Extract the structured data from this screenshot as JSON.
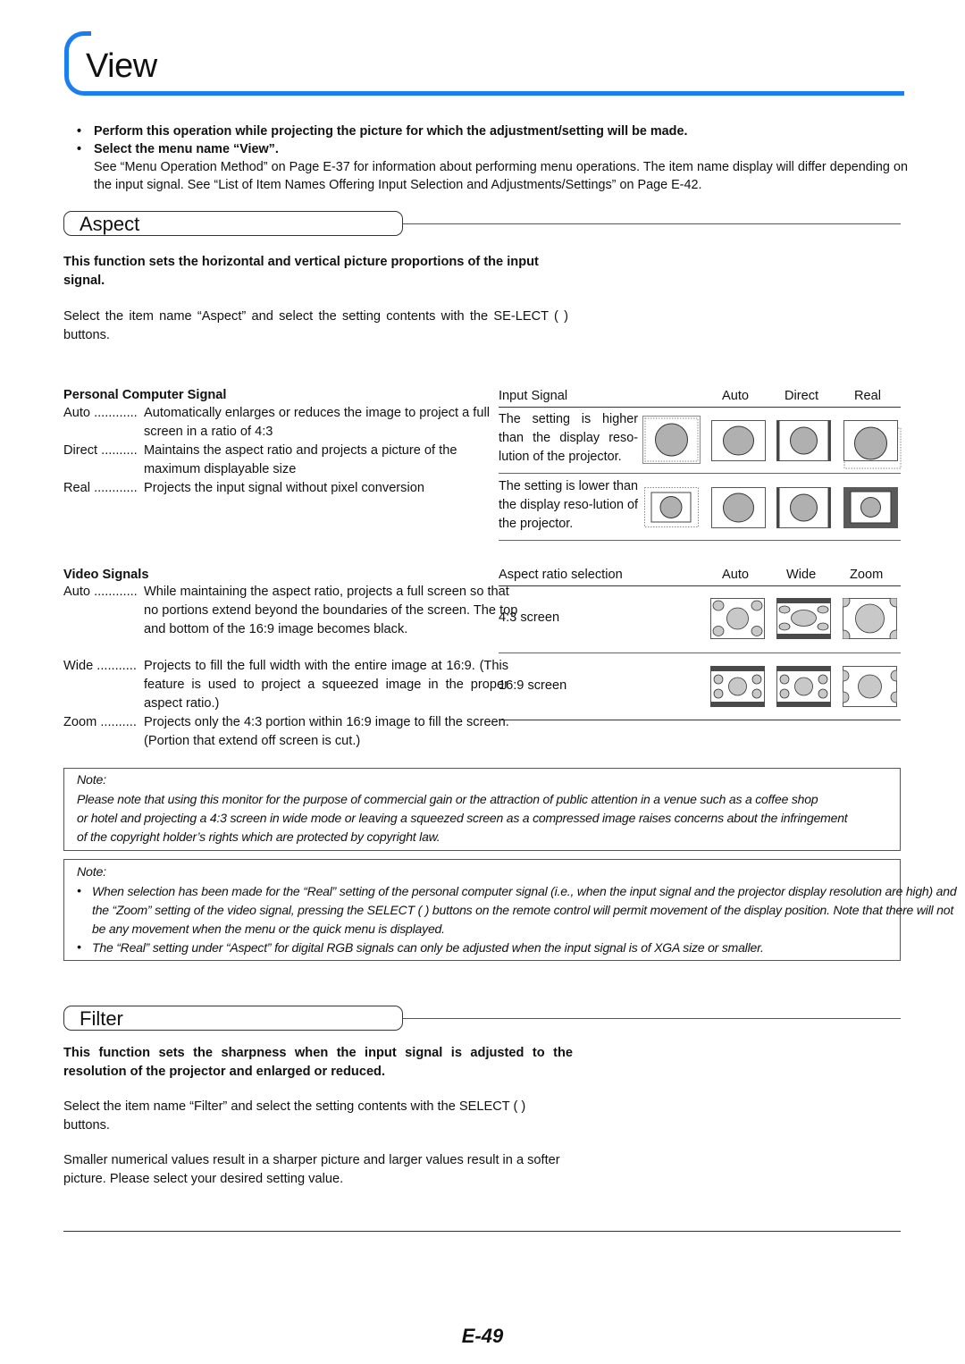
{
  "page": {
    "title": "View",
    "page_number": "E-49",
    "accent_color": "#1a7ef0"
  },
  "intro": {
    "bullet_1": "Perform this operation while projecting the picture for which the adjustment/setting will be made.",
    "bullet_2": "Select the menu name “View”.",
    "paragraph": "See “Menu Operation Method” on Page E-37 for information about performing menu operations. The item name display will differ depending on the input signal. See “List of Item Names Offering Input Selection and Adjustments/Settings” on Page E-42."
  },
  "aspect": {
    "heading": "Aspect",
    "summary": "This function sets the horizontal and vertical picture proportions of the input signal.",
    "instruction": "Select the item name “Aspect” and select the setting contents with the SE-LECT (      ) buttons.",
    "pc_signal": {
      "heading": "Personal Computer Signal",
      "items": [
        {
          "term": "Auto ............",
          "desc": "Automatically enlarges or reduces the image to project a full screen in a ratio of 4:3"
        },
        {
          "term": "Direct ..........",
          "desc": "Maintains the aspect ratio and projects a picture of the maximum displayable size"
        },
        {
          "term": "Real ............",
          "desc": "Projects the input signal without pixel conversion"
        }
      ]
    },
    "pc_table": {
      "header": [
        "Input Signal",
        "Auto",
        "Direct",
        "Real"
      ],
      "rows": [
        {
          "label": "The setting is higher than the display reso-lution of the projector."
        },
        {
          "label": "The setting is lower than the display reso-lution of the projector."
        }
      ]
    },
    "video_signals": {
      "heading": "Video Signals",
      "items": [
        {
          "term": "Auto ............",
          "desc": "While maintaining the aspect ratio, projects a full screen so that no portions extend beyond the boundaries of the screen. The top and bottom of the 16:9 image becomes black."
        },
        {
          "term": "Wide ...........",
          "desc": "Projects to fill the full width with the entire image at 16:9. (This feature is used to project a squeezed image in the proper aspect ratio.)"
        },
        {
          "term": "Zoom ..........",
          "desc": "Projects only the 4:3 portion within 16:9 image to fill the screen. (Portion that extend off screen is cut.)"
        }
      ]
    },
    "video_table": {
      "header": [
        "Aspect ratio selection",
        "Auto",
        "Wide",
        "Zoom"
      ],
      "rows": [
        {
          "label": "4:3 screen"
        },
        {
          "label": "16:9 screen"
        }
      ]
    }
  },
  "notes": [
    {
      "title": "Note:",
      "lines": [
        "Please note that using this monitor for the purpose of commercial gain or the attraction of public attention in a venue such as a coffee shop",
        "or hotel and projecting a 4:3 screen in wide mode or leaving a squeezed screen as a compressed image raises concerns about the infringement",
        "of the copyright holder’s rights which are protected by copyright law."
      ]
    },
    {
      "title": "Note:",
      "bullets": [
        "When selection has been made for the “Real” setting of the personal computer signal (i.e., when the input signal and the projector display resolution are high) and the “Zoom” setting of the video signal, pressing the SELECT (      ) buttons on the remote control will permit movement of the display position. Note that there will not be any movement when the menu or the quick menu is displayed.",
        "The “Real” setting under “Aspect” for digital RGB signals can only be adjusted when the input signal is of XGA size or smaller."
      ]
    }
  ],
  "filter": {
    "heading": "Filter",
    "summary": "This function sets the sharpness when the input signal is adjusted to the resolution of the projector and enlarged or reduced.",
    "instruction": "Select the item name “Filter” and select the setting contents with the SELECT (      ) buttons.",
    "detail": "Smaller numerical values result in a sharper picture and larger values result in a softer picture. Please select your desired setting value."
  }
}
